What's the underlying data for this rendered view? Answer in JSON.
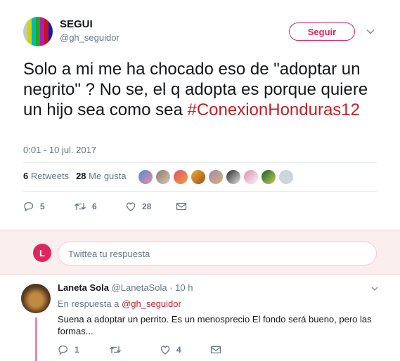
{
  "tweet": {
    "author_name": "SEGUI",
    "author_handle": "@gh_seguidor",
    "follow_label": "Seguir",
    "text": "Solo a mi me ha chocado eso de \"adoptar un negrito\" ? No se, el q adopta es porque quiere un hijo sea como sea",
    "hashtag": "#ConexionHonduras12",
    "timestamp": "0:01 - 10 jul. 2017",
    "stats": {
      "retweets_count": "6",
      "retweets_label": "Retweets",
      "likes_count": "28",
      "likes_label": "Me gusta"
    },
    "actions": {
      "reply_count": "5",
      "retweet_count": "6",
      "like_count": "28"
    }
  },
  "reply_box": {
    "avatar_letter": "L",
    "placeholder": "Twittea tu respuesta"
  },
  "reply": {
    "author_name": "Laneta Sola",
    "author_handle": "@LanetaSola",
    "time": "· 10 h",
    "in_reply_prefix": "En respuesta a",
    "in_reply_mention": "@gh_seguidor",
    "text": "Suena a adoptar un perrito. Es un menosprecio El fondo será bueno, pero las formas...",
    "actions": {
      "reply_count": "1",
      "retweet_count": "",
      "like_count": "4"
    }
  },
  "colors": {
    "accent": "#e0245e",
    "hashtag": "#c51d23",
    "muted": "#657786",
    "reply_bg": "#fbeeef"
  }
}
